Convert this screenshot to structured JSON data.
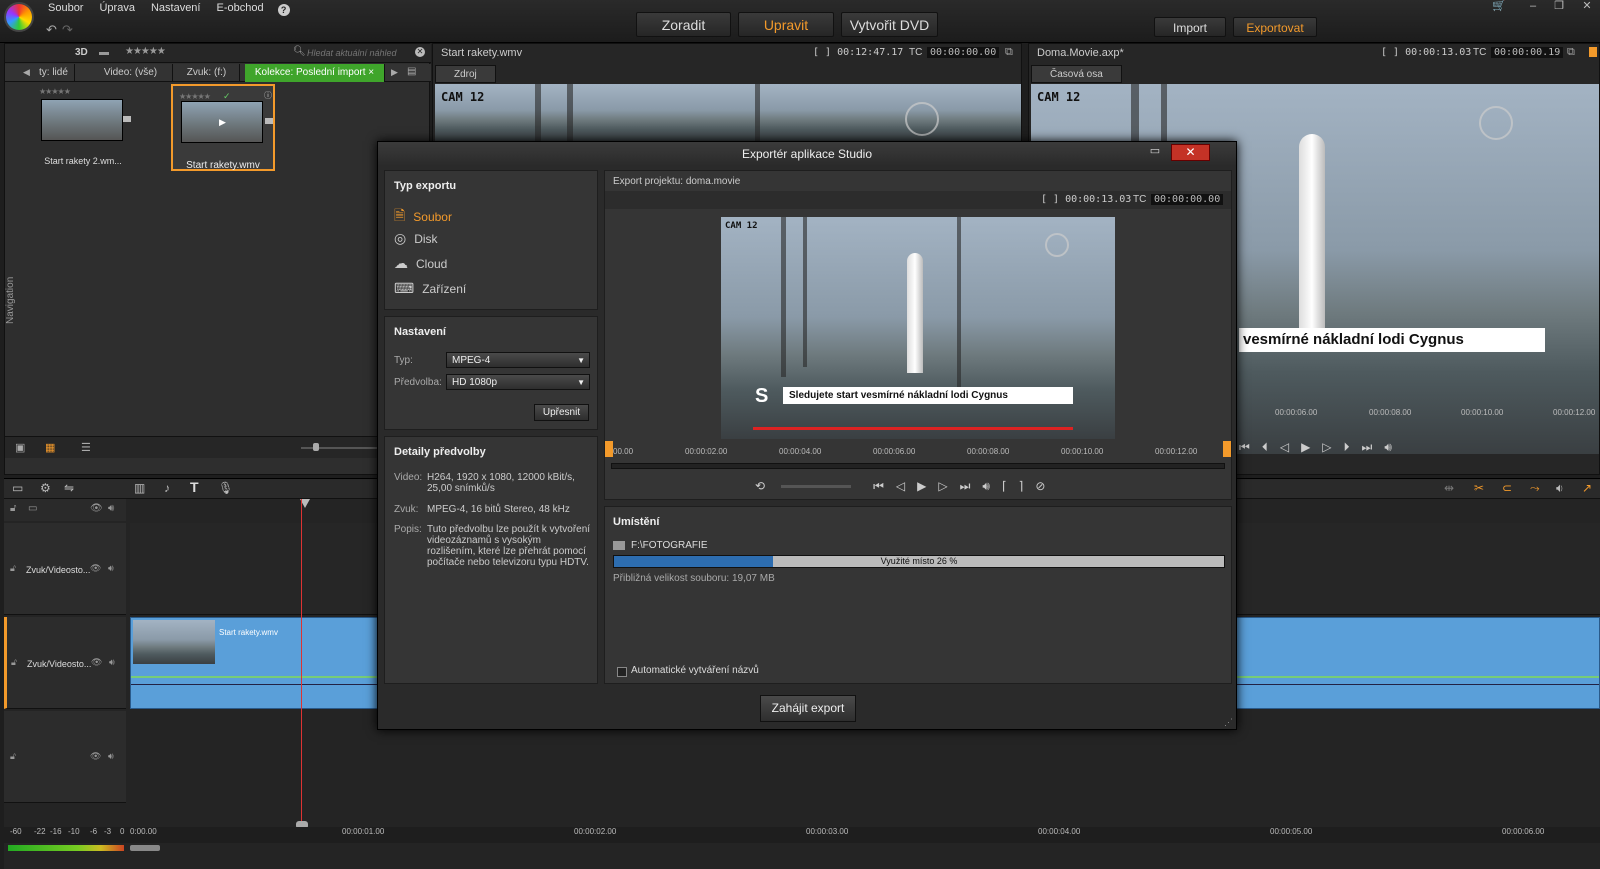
{
  "menu": {
    "items": [
      "Soubor",
      "Úprava",
      "Nastavení",
      "E-obchod"
    ],
    "help": "?"
  },
  "modes": {
    "arrange": "Zoradit",
    "edit": "Upravit",
    "dvd": "Vytvořit DVD"
  },
  "top_buttons": {
    "import": "Import",
    "export": "Exportovat"
  },
  "library": {
    "view_3d": "3D",
    "search_placeholder": "Hledat aktuální náhled",
    "tabs": [
      "ty: lidé",
      "Video: (vše)",
      "Zvuk: (f:)",
      "Kolekce: Poslední import"
    ],
    "items": [
      {
        "label": "Start rakety 2.wm...",
        "selected": false
      },
      {
        "label": "Start rakety.wmv",
        "selected": true
      }
    ],
    "nav_label": "Navigation"
  },
  "source_panel": {
    "title": "Start rakety.wmv",
    "duration": "[ ] 00:12:47.17",
    "tc_label": "TC",
    "tc": "00:00:00.00",
    "tab": "Zdroj",
    "cam_label": "CAM 12"
  },
  "timeline_panel": {
    "title": "Doma.Movie.axp*",
    "duration": "[ ] 00:00:13.03",
    "tc_label": "TC",
    "tc": "00:00:00.19",
    "tab": "Časová osa",
    "cam_label": "CAM 12",
    "caption": "vesmírné nákladní lodi Cygnus",
    "ruler": [
      "00:00:06.00",
      "00:00:08.00",
      "00:00:10.00",
      "00:00:12.00"
    ]
  },
  "timeline": {
    "tracks": [
      {
        "name": "Zvuk/Videosto..."
      },
      {
        "name": "Zvuk/Videosto...",
        "clip": "Start rakety.wmv"
      }
    ],
    "ruler": [
      "0:00.00",
      "00:00:01.00",
      "00:00:02.00",
      "00:00:03.00",
      "00:00:04.00",
      "00:00:05.00",
      "00:00:06.00"
    ],
    "meter_labels": [
      "-60",
      "-22",
      "-16",
      "-10",
      "-6",
      "-3",
      "0"
    ]
  },
  "dialog": {
    "title": "Exportér aplikace Studio",
    "export_type": {
      "title": "Typ exportu",
      "options": [
        {
          "label": "Soubor",
          "icon": "file-icon",
          "active": true
        },
        {
          "label": "Disk",
          "icon": "disc-icon",
          "active": false
        },
        {
          "label": "Cloud",
          "icon": "cloud-icon",
          "active": false
        },
        {
          "label": "Zařízení",
          "icon": "device-icon",
          "active": false
        }
      ]
    },
    "settings": {
      "title": "Nastavení",
      "type_label": "Typ:",
      "type_value": "MPEG-4",
      "preset_label": "Předvolba:",
      "preset_value": "HD 1080p",
      "refine_button": "Upřesnit"
    },
    "preset_details": {
      "title": "Detaily předvolby",
      "video_label": "Video:",
      "video_value": "H264, 1920 x 1080, 12000 kBit/s, 25,00 snímků/s",
      "audio_label": "Zvuk:",
      "audio_value": "MPEG-4, 16 bitů Stereo, 48 kHz",
      "desc_label": "Popis:",
      "desc_value": "Tuto předvolbu lze použít k vytvoření videozáznamů s vysokým rozlišením, které lze přehrát pomocí počítače nebo televizoru typu HDTV."
    },
    "preview": {
      "project_label": "Export projektu: doma.movie",
      "duration": "[ ] 00:00:13.03",
      "tc_label": "TC",
      "tc": "00:00:00.00",
      "cam_label": "CAM 12",
      "caption": "Sledujete start vesmírné nákladní lodi Cygnus",
      "ruler": [
        "00.00",
        "00:00:02.00",
        "00:00:04.00",
        "00:00:06.00",
        "00:00:08.00",
        "00:00:10.00",
        "00:00:12.00"
      ]
    },
    "location": {
      "title": "Umístění",
      "folder": "F:\\FOTOGRAFIE",
      "usage_label": "Využité místo 26 %",
      "usage_fraction": 0.26,
      "size_text": "Přibližná velikost souboru: 19,07 MB",
      "auto_name_label": "Automatické vytváření názvů",
      "auto_name_checked": false
    },
    "start_button": "Zahájit export"
  }
}
